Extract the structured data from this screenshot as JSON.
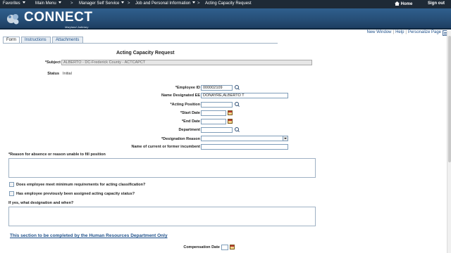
{
  "topnav": {
    "favorites": "Favorites",
    "main_menu": "Main Menu",
    "manager_self_service": "Manager Self Service",
    "job_and_personal": "Job and Personal Information",
    "current_page": "Acting Capacity Request",
    "home": "Home",
    "sign_out": "Sign out"
  },
  "banner": {
    "logo_text": "CONNECT",
    "logo_sub": "Maryland Judiciary"
  },
  "pagelinks": {
    "new_window": "New Window",
    "help": "Help",
    "personalize": "Personalize Page"
  },
  "tabs": [
    "Form",
    "Instructions",
    "Attachments"
  ],
  "form": {
    "title": "Acting Capacity Request",
    "subject_label": "*Subject",
    "subject_value": "ALBERTO - DC-Frederick County - ACTCAPCT",
    "status_label": "Status",
    "status_value": "Initial",
    "employee_id_label": "*Employee ID",
    "employee_id_value": "000002109",
    "name_designated_label": "Name Designated EE",
    "name_designated_value": "DONAYRE,ALBERTO T",
    "acting_position_label": "*Acting Position",
    "acting_position_value": "",
    "start_date_label": "*Start Date",
    "start_date_value": "",
    "end_date_label": "*End Date",
    "end_date_value": "",
    "department_label": "Department",
    "department_value": "",
    "designation_reason_label": "*Designation Reason",
    "designation_reason_value": "",
    "incumbent_label": "Name of current or former incumbent",
    "incumbent_value": "",
    "reason_label": "*Reason for absence or reason unable to fill position",
    "min_req_label": "Does employee meet minimum requirements for acting classification?",
    "prev_assigned_label": "Has employee previously been assigned acting capacity status?",
    "if_yes_label": "If yes, what designation and when?",
    "hr_section_link": "This section to be completed by the Human Resources Department Only",
    "compensation_date_label": "Compensation Date",
    "compensation_date_value": ""
  },
  "colors": {
    "topnav_bg": "#1e2a36",
    "banner_bg": "#2f5f8d",
    "link": "#1d4f89"
  }
}
